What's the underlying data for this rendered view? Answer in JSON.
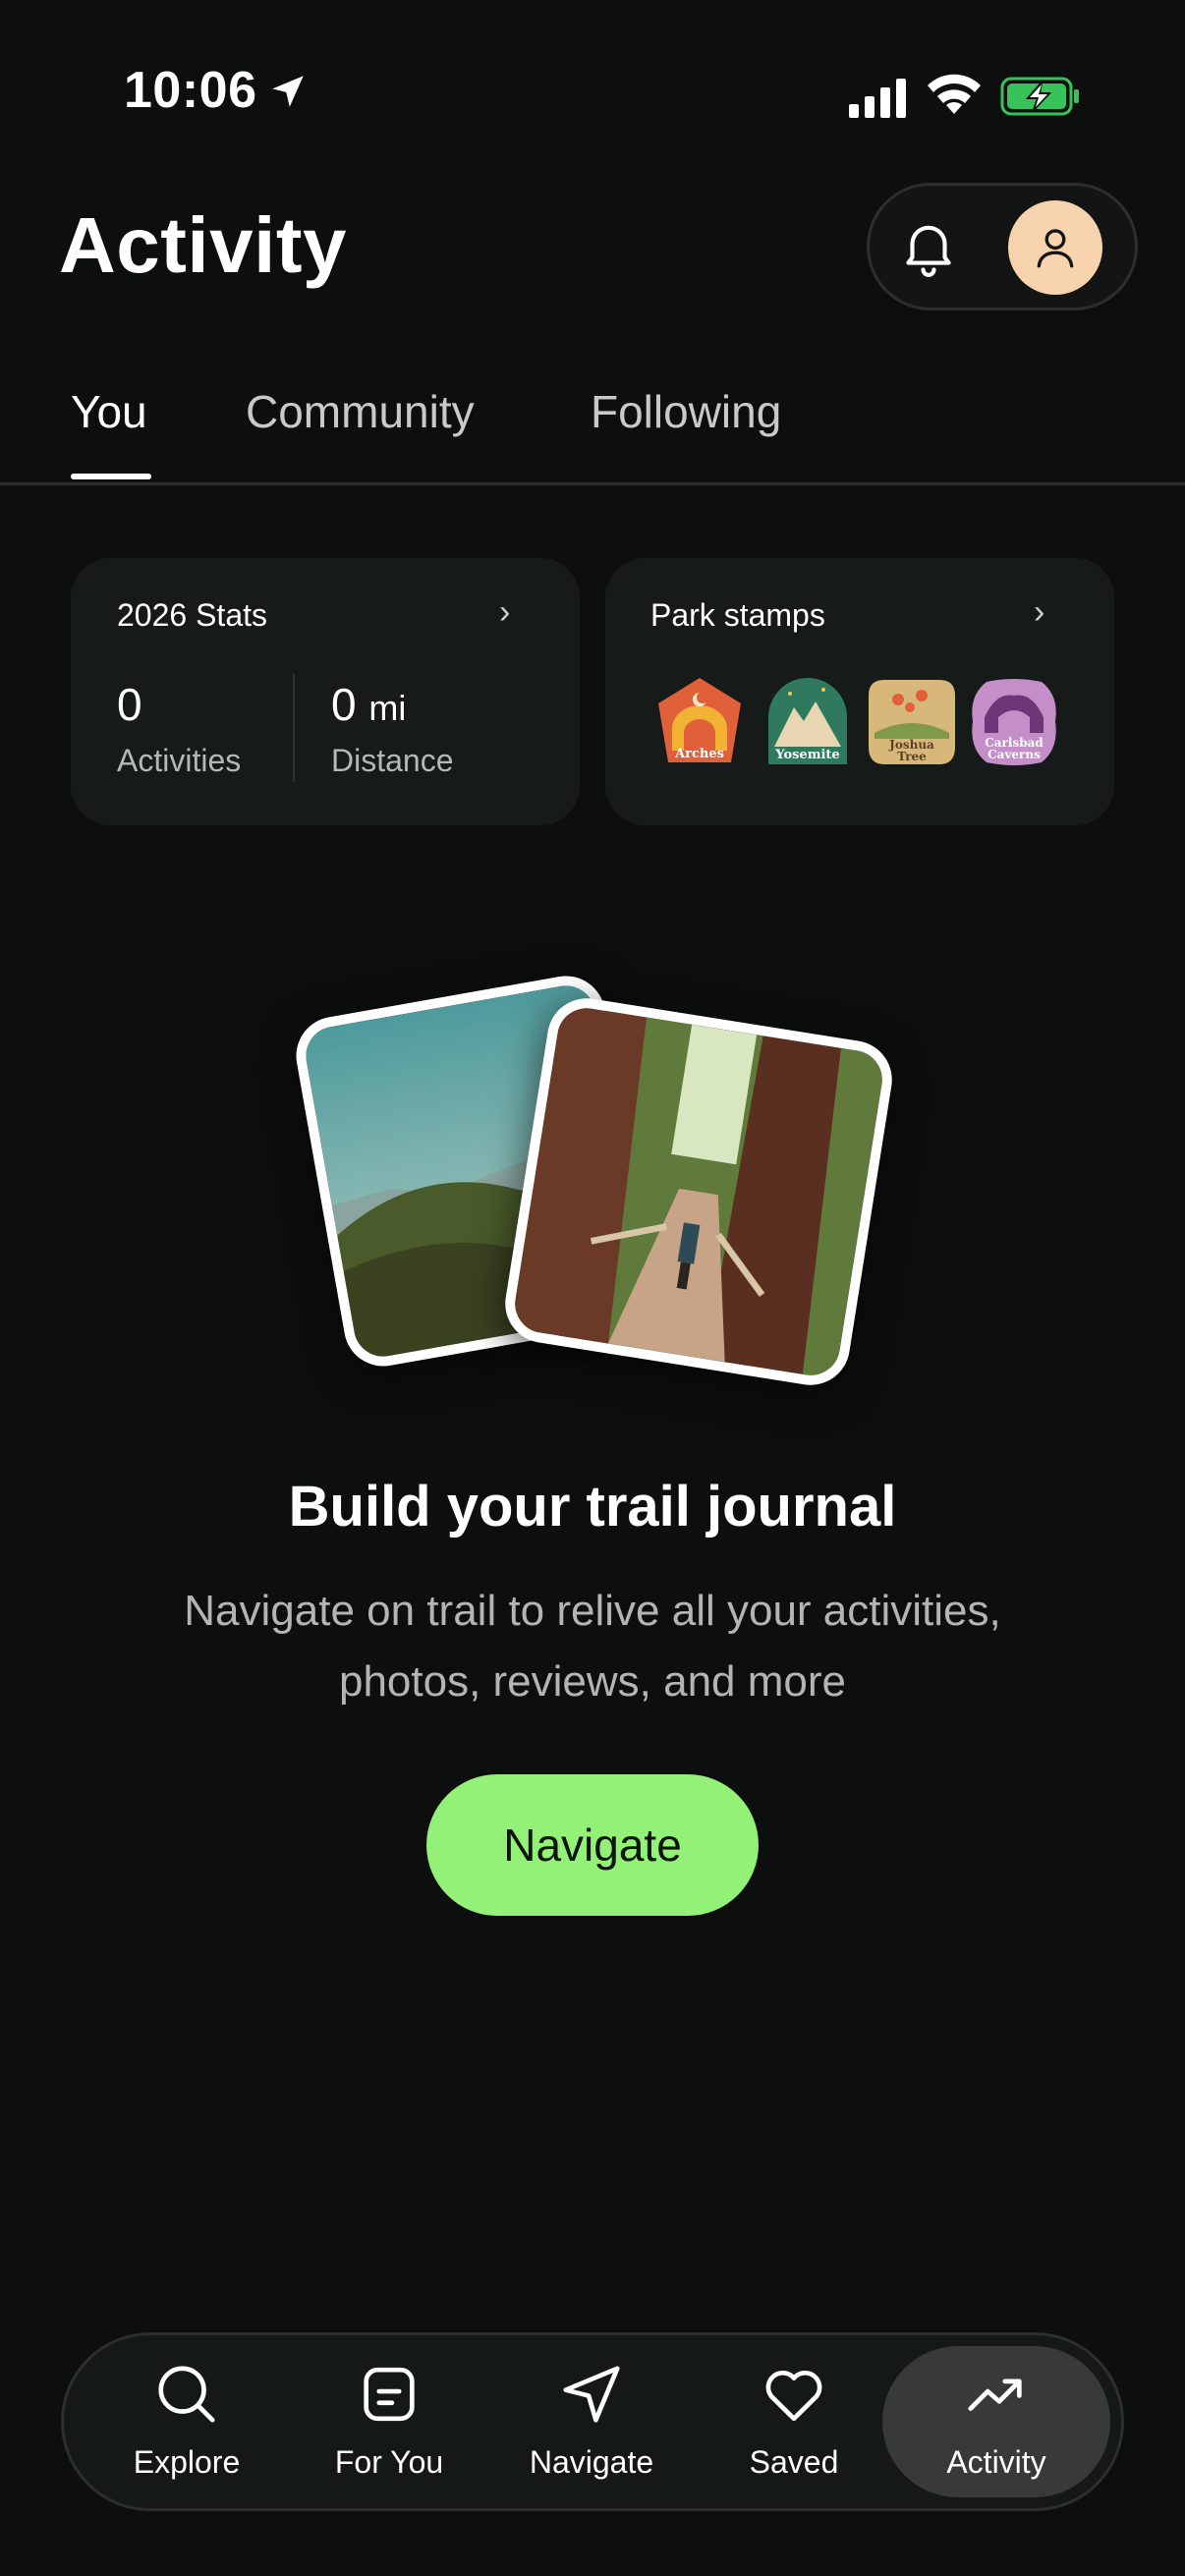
{
  "status_bar": {
    "time": "10:06",
    "icons": [
      "location-arrow-icon",
      "cell-signal-icon",
      "wifi-icon",
      "battery-charging-icon"
    ]
  },
  "header": {
    "title": "Activity",
    "icons": [
      "bell-icon",
      "avatar-person-icon"
    ]
  },
  "tabs": [
    {
      "label": "You",
      "active": true
    },
    {
      "label": "Community",
      "active": false
    },
    {
      "label": "Following",
      "active": false
    }
  ],
  "stats_card": {
    "title": "2026 Stats",
    "activities_value": "0",
    "activities_label": "Activities",
    "distance_value": "0",
    "distance_unit": "mi",
    "distance_label": "Distance"
  },
  "stamps_card": {
    "title": "Park stamps",
    "stamps": [
      {
        "name": "Arches",
        "color": "#e0603a"
      },
      {
        "name": "Yosemite",
        "color": "#2f7a5e"
      },
      {
        "name": "Joshua Tree",
        "color": "#d8b87a"
      },
      {
        "name": "Carlsbad Caverns",
        "color": "#c48fc9"
      }
    ]
  },
  "journal": {
    "title": "Build your trail journal",
    "subtitle_line1": "Navigate on trail to relive all your activities,",
    "subtitle_line2": "photos, reviews, and more",
    "button_label": "Navigate"
  },
  "bottom_nav": {
    "items": [
      {
        "label": "Explore",
        "icon": "search-icon",
        "active": false
      },
      {
        "label": "For You",
        "icon": "for-you-icon",
        "active": false
      },
      {
        "label": "Navigate",
        "icon": "navigate-arrow-icon",
        "active": false
      },
      {
        "label": "Saved",
        "icon": "heart-icon",
        "active": false
      },
      {
        "label": "Activity",
        "icon": "trend-icon",
        "active": true
      }
    ]
  },
  "colors": {
    "background": "#0d0f0e",
    "card": "#161a18",
    "accent_green": "#93f177",
    "avatar_bg": "#f7d3ae",
    "battery_green": "#37c25a"
  }
}
